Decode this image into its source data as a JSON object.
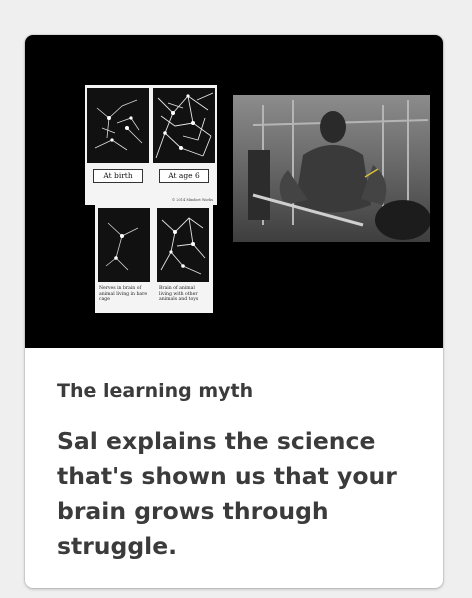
{
  "card": {
    "title": "The learning myth",
    "description": "Sal explains the science that's shown us that your brain grows through struggle."
  },
  "thumbnail": {
    "label_birth": "At birth",
    "label_age6": "At age 6",
    "copyright": "© 2014 Mindset Works",
    "caption_left": "Nerves in brain of animal living in bare cage",
    "caption_right": "Brain of animal living with other animals and toys"
  }
}
